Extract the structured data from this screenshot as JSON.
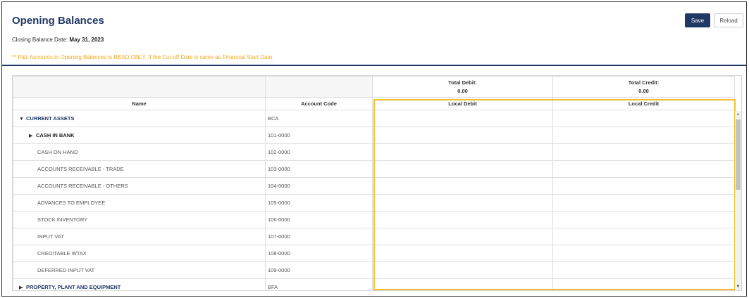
{
  "header": {
    "title": "Opening Balances",
    "closing_label": "Closing Balance Date:",
    "closing_date": "May 31, 2023",
    "warning": "** P&L Accounts in Opening Balances is READ ONLY, If the Cut-off Date is same as Financial Start Date.",
    "save_label": "Save",
    "reload_label": "Reload"
  },
  "totals": {
    "debit_label": "Total Debit:",
    "debit_value": "0.00",
    "credit_label": "Total Credit:",
    "credit_value": "0.00"
  },
  "columns": {
    "name": "Name",
    "code": "Account Code",
    "debit": "Local Debit",
    "credit": "Local Credit"
  },
  "rows": [
    {
      "name": "CURRENT ASSETS",
      "code": "BCA",
      "level": 0,
      "caret": "down"
    },
    {
      "name": "CASH IN BANK",
      "code": "101-0000",
      "level": 1,
      "caret": "right"
    },
    {
      "name": "CASH ON HAND",
      "code": "102-0000",
      "level": 2
    },
    {
      "name": "ACCOUNTS RECEIVABLE - TRADE",
      "code": "103-0000",
      "level": 2
    },
    {
      "name": "ACCOUNTS RECEIVABLE - OTHERS",
      "code": "104-0000",
      "level": 2
    },
    {
      "name": "ADVANCES TO EMPLOYEE",
      "code": "105-0000",
      "level": 2
    },
    {
      "name": "STOCK INVENTORY",
      "code": "106-0000",
      "level": 2
    },
    {
      "name": "INPUT VAT",
      "code": "107-0000",
      "level": 2
    },
    {
      "name": "CREDITABLE WTAX",
      "code": "108-0000",
      "level": 2
    },
    {
      "name": "DEFERRED INPUT VAT",
      "code": "109-0000",
      "level": 2
    },
    {
      "name": "PROPERTY, PLANT AND EQUIPMENT",
      "code": "BFA",
      "level": 0,
      "caret": "right"
    }
  ],
  "colors": {
    "primary": "#1f3864",
    "warning": "#f0a71c",
    "highlight": "#f5c133"
  }
}
